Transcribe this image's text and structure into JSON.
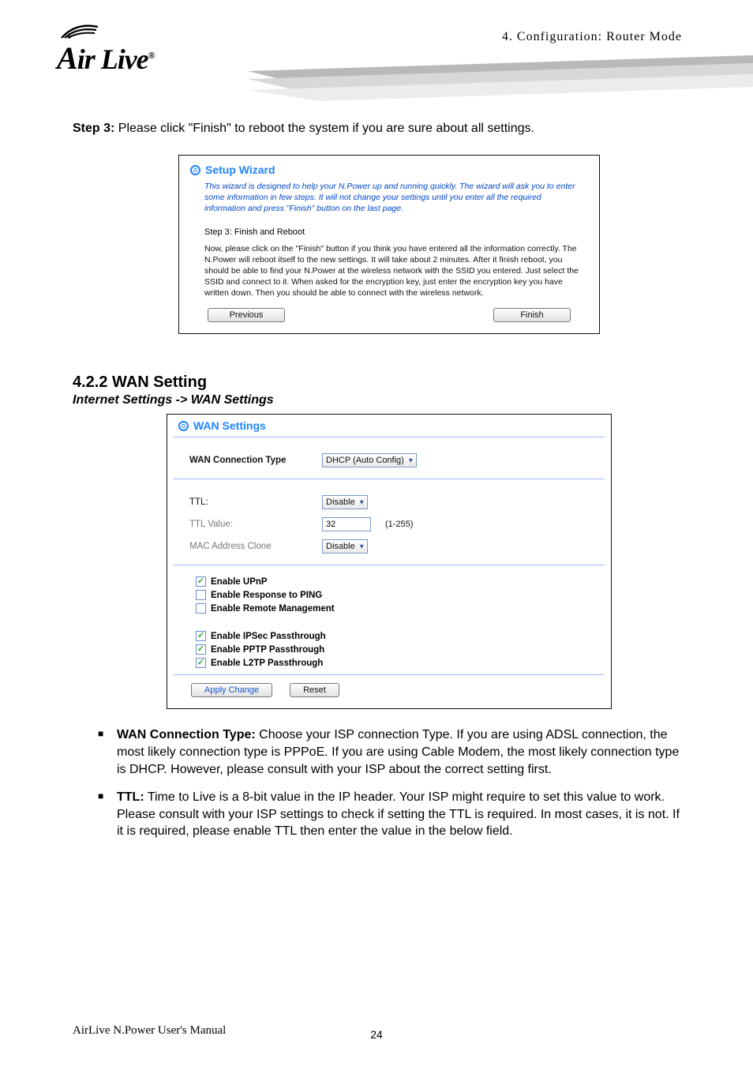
{
  "header": {
    "logo_text_prefix": "A",
    "logo_text_rest": "ir Live",
    "chapter_label": "4.  Configuration:  Router  Mode"
  },
  "step3": {
    "label": "Step 3:",
    "text": " Please click \"Finish\" to reboot the system if you are sure about all settings."
  },
  "wizard_panel": {
    "title": "Setup Wizard",
    "intro": "This wizard is designed to help your N.Power up and running quickly. The wizard will ask you to enter some information in few steps. It will not change your settings until you enter all the required information and press \"Finish\" button on the last page.",
    "step_name": "Step 3: Finish and Reboot",
    "step_body": "Now, please click on the \"Finish\" button if you think you have entered all the information correctly. The N.Power will reboot itself to the new settings. It will take about 2 minutes. After it finish reboot, you should be able to find your N.Power at the wireless network with the SSID you entered. Just select the SSID and connect to it. When asked for the encryption key, just enter the encryption key you have written down. Then you should be able to connect with the wireless network.",
    "btn_prev": "Previous",
    "btn_finish": "Finish"
  },
  "section": {
    "heading": "4.2.2 WAN Setting",
    "path": "Internet Settings -> WAN Settings"
  },
  "wan_panel": {
    "title": "WAN Settings",
    "rows": {
      "conn_type_label": "WAN Connection Type",
      "conn_type_value": "DHCP (Auto Config)",
      "ttl_label": "TTL:",
      "ttl_value": "Disable",
      "ttlval_label": "TTL Value:",
      "ttlval_value": "32",
      "ttlval_hint": "(1-255)",
      "mac_label": "MAC Address Clone",
      "mac_value": "Disable"
    },
    "checks": [
      {
        "label": "Enable UPnP",
        "checked": true
      },
      {
        "label": "Enable Response to PING",
        "checked": false
      },
      {
        "label": "Enable Remote Management",
        "checked": false
      },
      {
        "label": "Enable IPSec Passthrough",
        "checked": true
      },
      {
        "label": "Enable PPTP Passthrough",
        "checked": true
      },
      {
        "label": "Enable L2TP Passthrough",
        "checked": true
      }
    ],
    "btn_apply": "Apply Change",
    "btn_reset": "Reset"
  },
  "bullets": {
    "b1_label": "WAN Connection Type:",
    "b1_text": " Choose your ISP connection Type. If you are using ADSL connection, the most likely connection type is PPPoE.    If you are using Cable Modem, the most likely connection type is DHCP.    However, please consult with your ISP about the correct setting first.",
    "b2_label": "TTL:",
    "b2_text": "   Time to Live is a 8-bit value in the IP header. Your ISP might require to set this value to work.    Please consult with your ISP settings to check if setting the TTL is required.    In most cases, it is not.    If it is required, please enable TTL then enter the value in the below field."
  },
  "footer": {
    "manual": "AirLive N.Power User's Manual",
    "page": "24"
  }
}
